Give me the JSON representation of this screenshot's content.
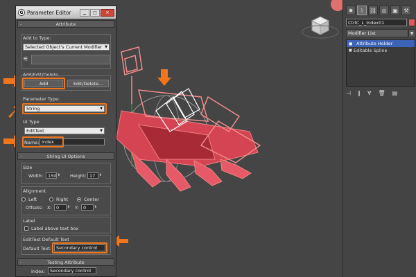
{
  "dialog": {
    "title": "Parameter Editor",
    "btn_min": "▁",
    "btn_max": "□",
    "btn_close": "✕",
    "attribute_rollout": "Attribute",
    "add_to_type_label": "Add to Type:",
    "add_to_type_value": "Selected Object's Current Modifier",
    "add_edit_delete_label": "Add/Edit/Delete",
    "add_button": "Add",
    "edit_delete_button": "Edit/Delete...",
    "parameter_type_label": "Parameter Type:",
    "parameter_type_value": "String",
    "ui_type_label": "UI Type",
    "ui_type_value": "EditText",
    "name_label": "Name:",
    "name_value": "Index",
    "string_ui_rollout": "String UI Options",
    "size_label": "Size",
    "width_label": "Width:",
    "width_value": "150",
    "height_label": "Height:",
    "height_value": "17",
    "alignment_label": "Alignment",
    "align_left": "Left",
    "align_right": "Right",
    "align_center": "Center",
    "offsets_label": "Offsets:",
    "offset_x_label": "X:",
    "offset_x_value": "0",
    "offset_y_label": "Y:",
    "offset_y_value": "0",
    "label_group": "Label",
    "label_above_text": "Label above text box",
    "edittext_default_group": "EditText Default Text",
    "default_text_label": "Default Text:",
    "default_text_value": "Secondary control",
    "testing_rollout": "Testing Attribute",
    "index_label": "Index:",
    "index_value": "Secondary control",
    "minus": "-"
  },
  "command_panel": {
    "object_name": "CtrlC_L_Index01",
    "modifier_list": "Modifier List",
    "stack": [
      "Attribute Holder",
      "Editable Spline"
    ],
    "tab_icons": [
      "create-icon",
      "modify-icon",
      "hierarchy-icon",
      "motion-icon",
      "display-icon",
      "utilities-icon"
    ]
  },
  "colors": {
    "highlight": "#f0761c",
    "selected_stack": "#3d63b8",
    "object_color": "#e04050"
  }
}
